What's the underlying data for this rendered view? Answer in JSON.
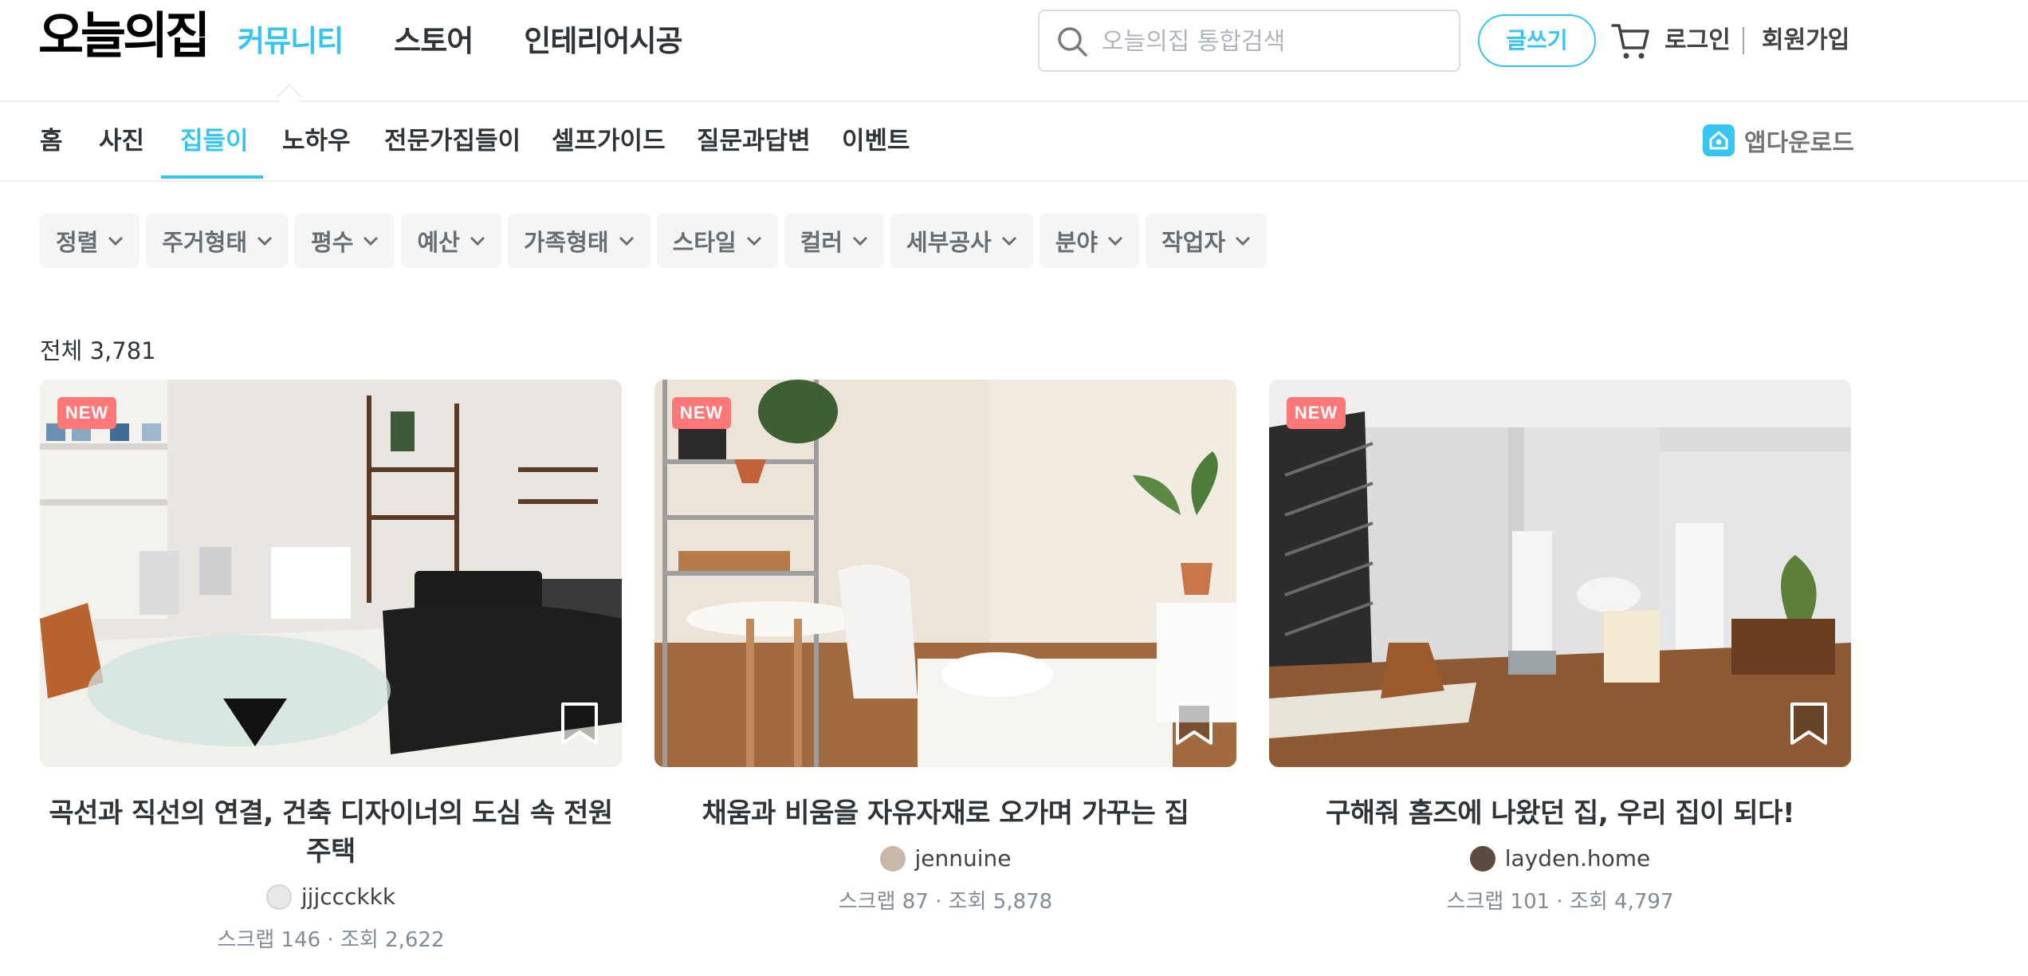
{
  "header": {
    "logo": "오늘의집",
    "nav": [
      "커뮤니티",
      "스토어",
      "인테리어시공"
    ],
    "search_placeholder": "오늘의집 통합검색",
    "write_label": "글쓰기",
    "login_label": "로그인",
    "signup_label": "회원가입"
  },
  "subnav": {
    "items": [
      "홈",
      "사진",
      "집들이",
      "노하우",
      "전문가집들이",
      "셀프가이드",
      "질문과답변",
      "이벤트"
    ],
    "app_download": "앱다운로드"
  },
  "filters": [
    "정렬",
    "주거형태",
    "평수",
    "예산",
    "가족형태",
    "스타일",
    "컬러",
    "세부공사",
    "분야",
    "작업자"
  ],
  "total_label": "전체 3,781",
  "cards": [
    {
      "badge": "NEW",
      "title": "곡선과 직선의 연결, 건축 디자이너의 도심 속 전원주택",
      "author": "jjjccckkk",
      "stats": "스크랩 146 · 조회 2,622"
    },
    {
      "badge": "NEW",
      "title": "채움과 비움을 자유자재로 오가며 가꾸는 집",
      "author": "jennuine",
      "stats": "스크랩 87 · 조회 5,878"
    },
    {
      "badge": "NEW",
      "title": "구해줘 홈즈에 나왔던 집, 우리 집이 되다!",
      "author": "layden.home",
      "stats": "스크랩 101 · 조회 4,797"
    }
  ],
  "colors": {
    "accent": "#35c5f0",
    "badge": "#ff7777",
    "text": "#2f3438",
    "muted": "#828c94"
  }
}
